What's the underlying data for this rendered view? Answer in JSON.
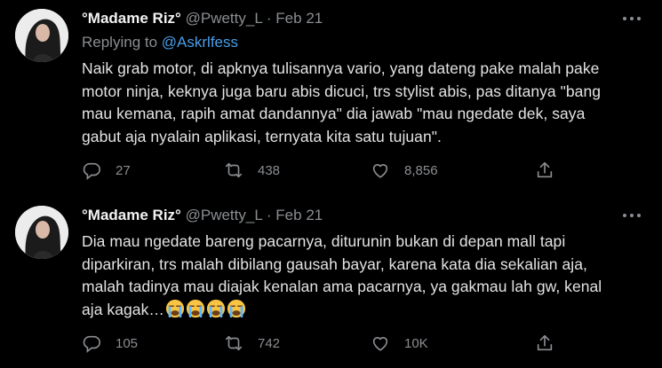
{
  "colors": {
    "background": "#000000",
    "text": "#e3e3e3",
    "secondary": "#8a8d91",
    "link": "#4a9ee8"
  },
  "tweets": [
    {
      "display_name": "°Madame Riz°",
      "handle": "@Pwetty_L",
      "separator": "·",
      "date": "Feb 21",
      "replying_label": "Replying to",
      "replying_to": "@Askrlfess",
      "lines": [
        "Naik grab motor, di apknya tulisannya vario, yang dateng pake malah pake",
        "motor ninja, keknya juga baru abis dicuci, trs stylist abis, pas ditanya \"bang",
        "mau kemana, rapih amat dandannya\" dia jawab \"mau ngedate dek, saya",
        "gabut aja nyalain aplikasi, ternyata kita satu tujuan\"."
      ],
      "replies": "27",
      "retweets": "438",
      "likes": "8,856",
      "icons": [
        "avatar",
        "more-icon",
        "reply-icon",
        "retweet-icon",
        "like-icon",
        "share-icon"
      ]
    },
    {
      "display_name": "°Madame Riz°",
      "handle": "@Pwetty_L",
      "separator": "·",
      "date": "Feb 21",
      "lines": [
        "Dia mau ngedate bareng pacarnya, diturunin bukan di depan mall tapi",
        "diparkiran, trs malah dibilang gausah bayar, karena kata dia sekalian aja,",
        "malah tadinya mau diajak kenalan ama pacarnya, ya gakmau lah gw, kenal",
        "aja kagak…"
      ],
      "emoji": [
        "😭",
        "😭",
        "😭",
        "😭"
      ],
      "replies": "105",
      "retweets": "742",
      "likes": "10K",
      "icons": [
        "avatar",
        "more-icon",
        "reply-icon",
        "retweet-icon",
        "like-icon",
        "share-icon",
        "crying-face-emoji"
      ]
    }
  ]
}
